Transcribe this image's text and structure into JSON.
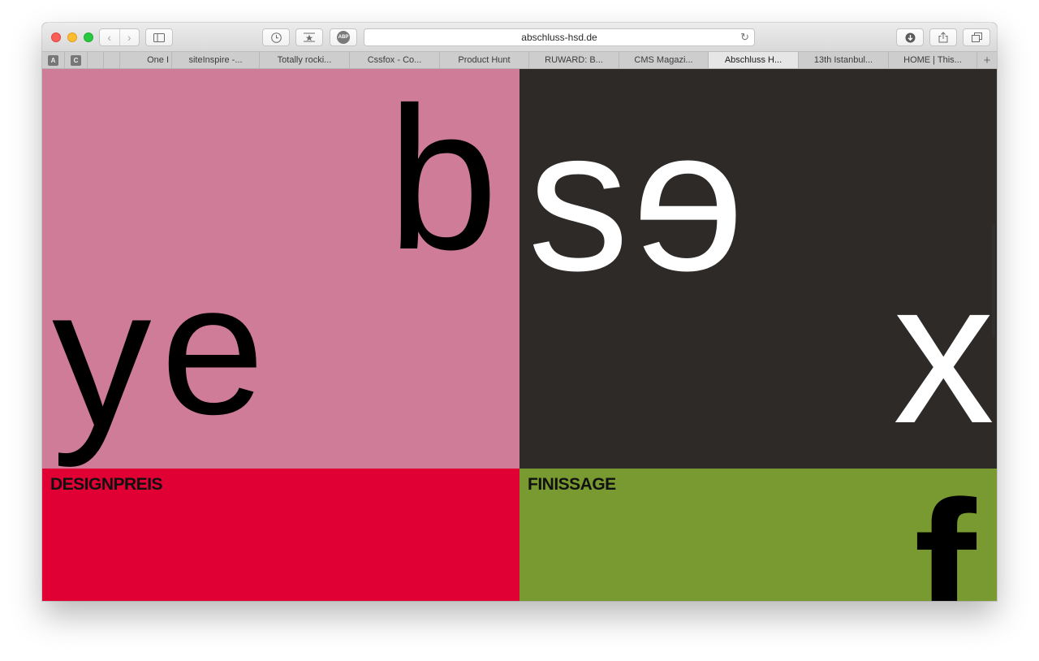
{
  "browser": {
    "url": "abschluss-hsd.de",
    "pinned_tabs": [
      {
        "letter": "A"
      },
      {
        "letter": "C"
      },
      {
        "letter": ""
      },
      {
        "letter": ""
      }
    ],
    "tabs": [
      {
        "label": "One I",
        "partial": true,
        "active": false
      },
      {
        "label": "siteInspire -...",
        "partial": false,
        "active": false
      },
      {
        "label": "Totally rocki...",
        "partial": false,
        "active": false
      },
      {
        "label": "Cssfox - Co...",
        "partial": false,
        "active": false
      },
      {
        "label": "Product Hunt",
        "partial": false,
        "active": false
      },
      {
        "label": "RUWARD: B...",
        "partial": false,
        "active": false
      },
      {
        "label": "CMS Magazi...",
        "partial": false,
        "active": false
      },
      {
        "label": "Abschluss H...",
        "partial": false,
        "active": true
      },
      {
        "label": "13th Istanbul...",
        "partial": false,
        "active": false
      },
      {
        "label": "HOME | This...",
        "partial": false,
        "active": false
      }
    ],
    "new_tab_symbol": "+",
    "abp_label": "ABP"
  },
  "page": {
    "colors": {
      "pink": "#cf7c99",
      "dark": "#2d2a28",
      "red": "#e00033",
      "green": "#789a31",
      "black": "#000000",
      "white": "#ffffff"
    },
    "letters": {
      "pink_b": "b",
      "pink_y": "y",
      "pink_e": "e",
      "dark_s": "s",
      "dark_e": "e",
      "dark_x": "x",
      "green_f": "f"
    },
    "sections": {
      "red_label": "DESIGNPREIS",
      "green_label": "FINISSAGE"
    }
  }
}
